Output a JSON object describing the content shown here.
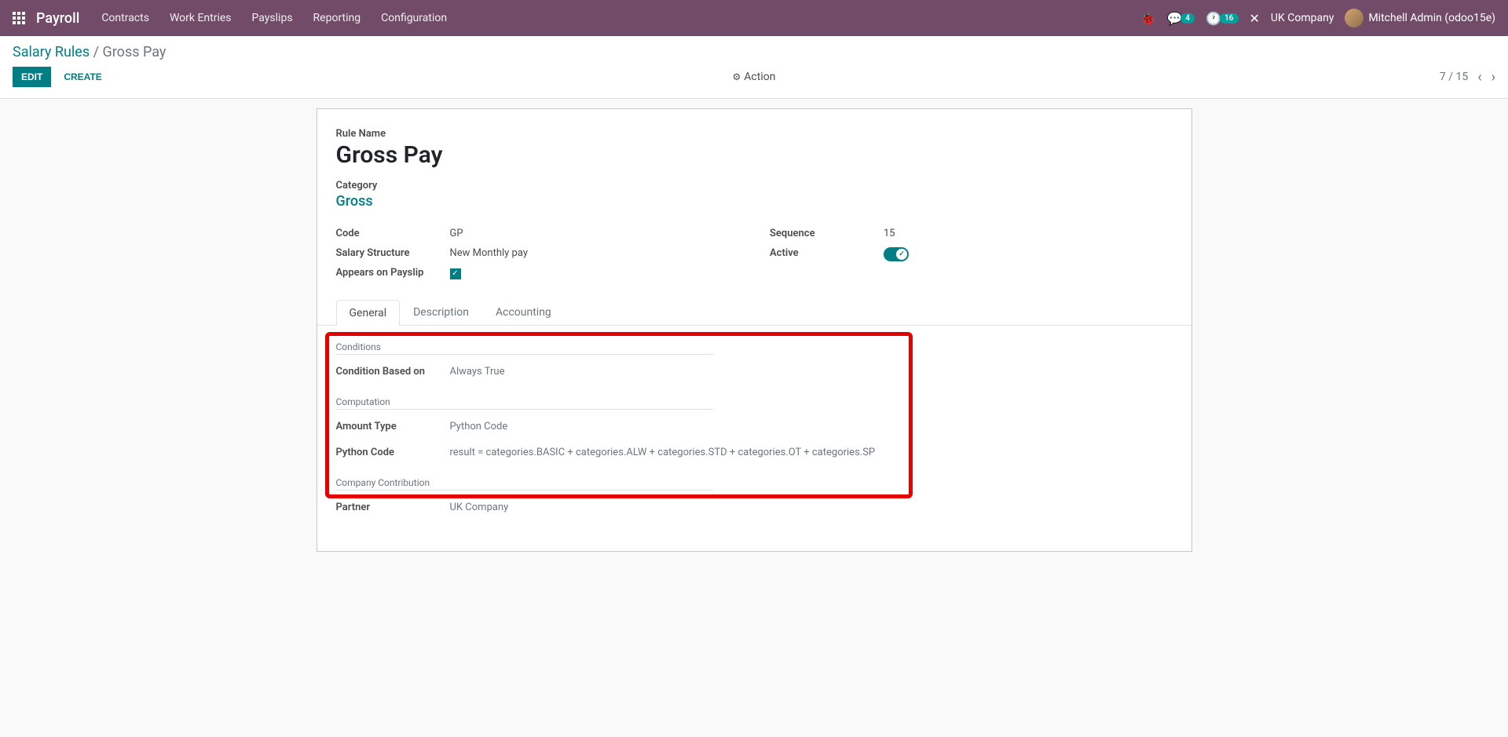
{
  "topbar": {
    "app_name": "Payroll",
    "nav": [
      "Contracts",
      "Work Entries",
      "Payslips",
      "Reporting",
      "Configuration"
    ],
    "msg_badge": "4",
    "activity_badge": "16",
    "company": "UK Company",
    "user": "Mitchell Admin (odoo15e)"
  },
  "breadcrumb": {
    "parent": "Salary Rules",
    "current": "Gross Pay"
  },
  "buttons": {
    "edit": "EDIT",
    "create": "CREATE",
    "action": "Action"
  },
  "pager": {
    "text": "7 / 15"
  },
  "form": {
    "rule_name_label": "Rule Name",
    "rule_name": "Gross Pay",
    "category_label": "Category",
    "category": "Gross",
    "code_label": "Code",
    "code": "GP",
    "salary_structure_label": "Salary Structure",
    "salary_structure": "New Monthly pay",
    "appears_label": "Appears on Payslip",
    "sequence_label": "Sequence",
    "sequence": "15",
    "active_label": "Active"
  },
  "tabs": {
    "general": "General",
    "description": "Description",
    "accounting": "Accounting"
  },
  "general": {
    "conditions_section": "Conditions",
    "condition_based_label": "Condition Based on",
    "condition_based": "Always True",
    "computation_section": "Computation",
    "amount_type_label": "Amount Type",
    "amount_type": "Python Code",
    "python_code_label": "Python Code",
    "python_code": "result =  categories.BASIC + categories.ALW + categories.STD + categories.OT + categories.SP",
    "company_section": "Company Contribution",
    "partner_label": "Partner",
    "partner": "UK Company"
  }
}
